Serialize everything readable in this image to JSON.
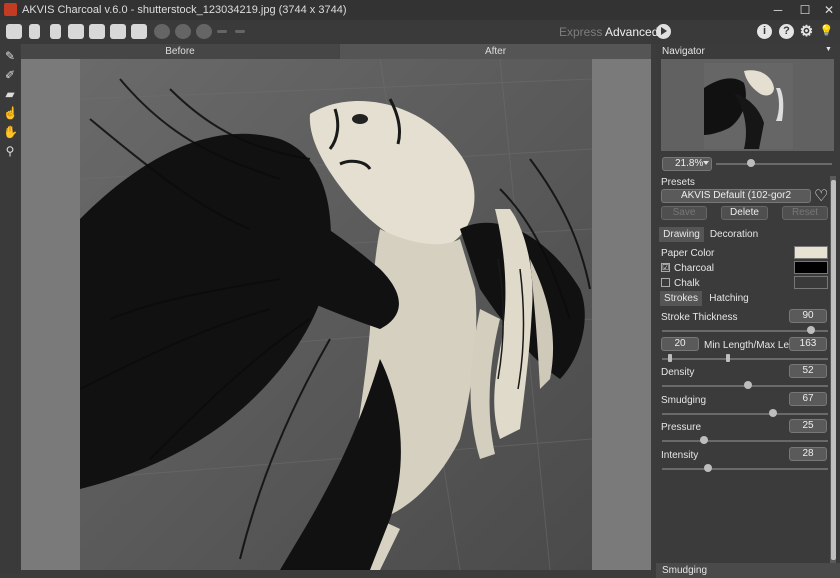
{
  "window": {
    "title": "AKVIS Charcoal v.6.0 - shutterstock_123034219.jpg (3744 x 3744)",
    "controls": {
      "minimize": "─",
      "maximize": "☐",
      "close": "✕"
    }
  },
  "toolbar": {
    "icons": [
      "home-icon",
      "open-icon",
      "save-icon",
      "print-icon",
      "share-icon",
      "batch-icon",
      "preferences-icon",
      "undo-icon",
      "redo-icon",
      "reset-icon",
      "back-arrow-icon",
      "forward-arrow-icon"
    ],
    "mode_express": "Express",
    "mode_advanced": "Advanced",
    "help_glyph": "?",
    "info_glyph": "i",
    "settings_glyph": "⚙",
    "bulb_glyph": "💡"
  },
  "tools": [
    "pencil-icon",
    "charcoal-pencil-icon",
    "eraser-icon",
    "smudge-icon",
    "hand-icon",
    "zoom-icon"
  ],
  "view_tabs": {
    "before": "Before",
    "after": "After"
  },
  "navigator": {
    "title": "Navigator",
    "collapse_glyph": "▼",
    "zoom": "21.8%",
    "zoom_fraction": 0.3
  },
  "presets": {
    "title": "Presets",
    "selected": "AKVIS Default (102-gor2",
    "save": "Save",
    "delete": "Delete",
    "reset": "Reset"
  },
  "tabs": {
    "drawing": "Drawing",
    "decoration": "Decoration"
  },
  "colors_section": {
    "paper_color_label": "Paper Color",
    "paper_color": "#e8e2d2",
    "charcoal_label": "Charcoal",
    "charcoal_checked": "☑",
    "charcoal_color": "#000000",
    "chalk_label": "Chalk",
    "chalk_color": "#3a3a3a"
  },
  "subtabs": {
    "strokes": "Strokes",
    "hatching": "Hatching"
  },
  "params": {
    "stroke_thickness": {
      "label": "Stroke Thickness",
      "value": "90",
      "level": 0.9
    },
    "length": {
      "label": "Min Length/Max Length",
      "min": "20",
      "max": "163",
      "min_level": 0.05,
      "max_level": 0.4
    },
    "density": {
      "label": "Density",
      "value": "52",
      "level": 0.52
    },
    "smudging": {
      "label": "Smudging",
      "value": "67",
      "level": 0.67
    },
    "pressure": {
      "label": "Pressure",
      "value": "25",
      "level": 0.25
    },
    "intensity": {
      "label": "Intensity",
      "value": "28",
      "level": 0.28
    }
  },
  "bottom_panel": {
    "label": "Smudging"
  }
}
